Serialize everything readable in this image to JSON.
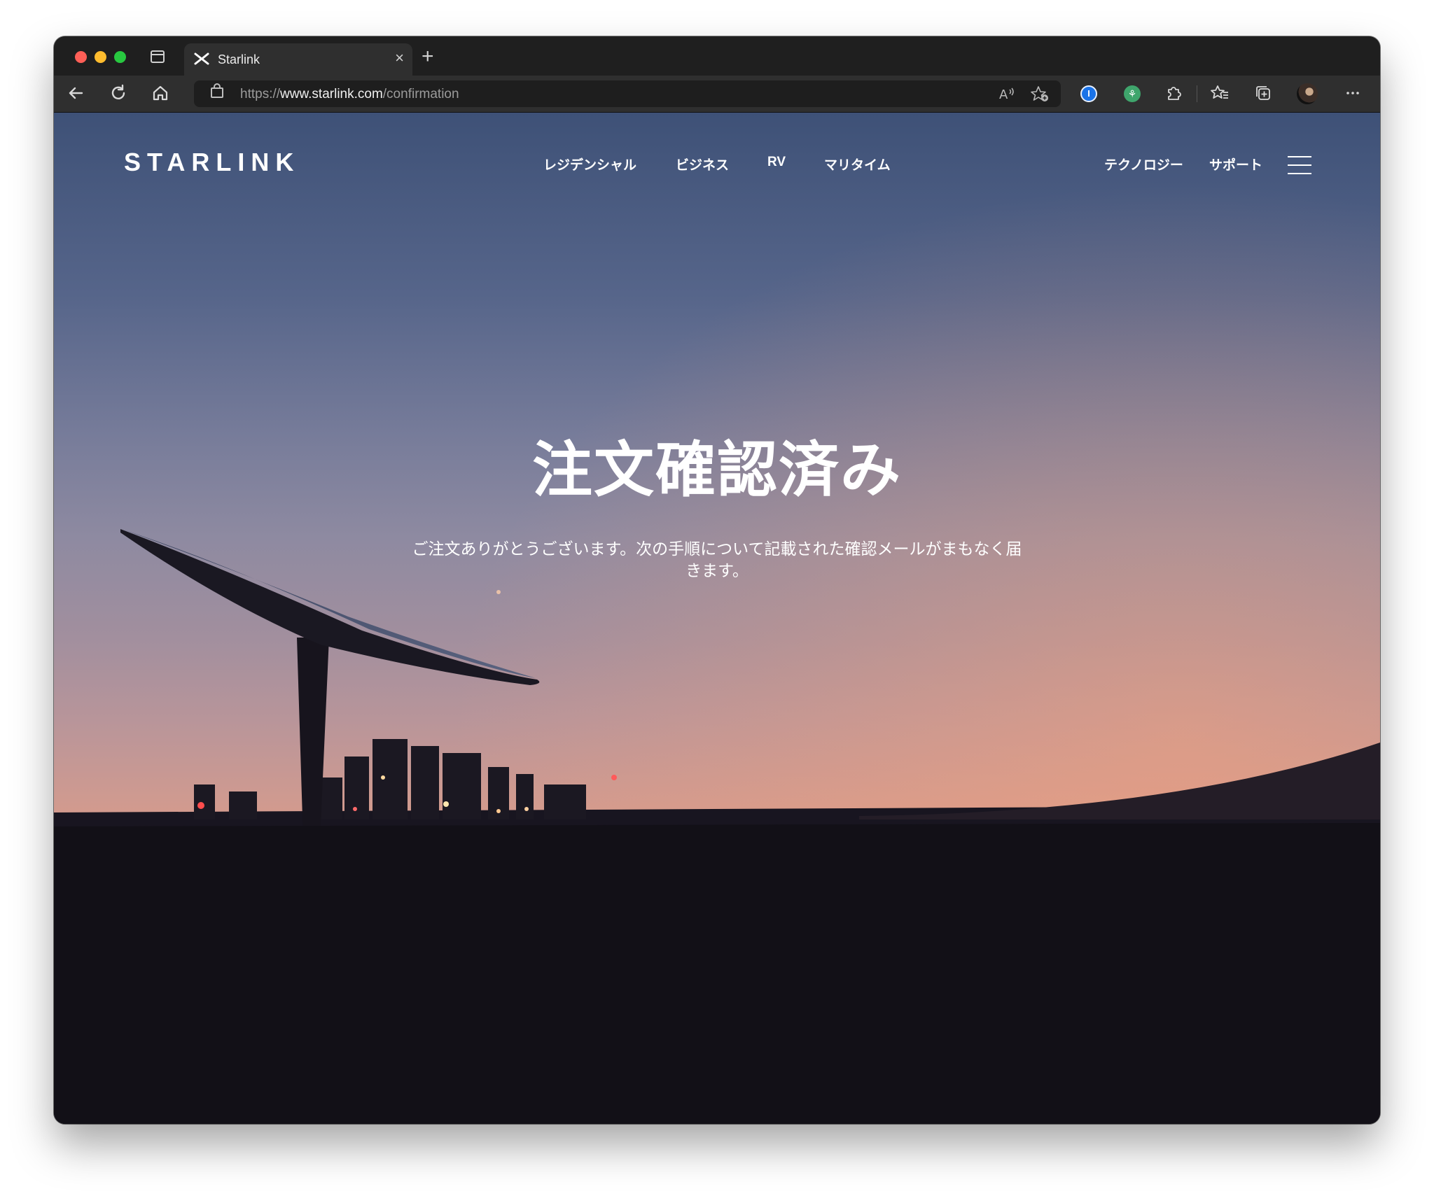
{
  "browser": {
    "tab": {
      "title": "Starlink",
      "close_glyph": "×"
    },
    "new_tab_glyph": "+",
    "url": {
      "scheme": "https://",
      "host": "www.starlink.com",
      "path": "/confirmation"
    }
  },
  "site": {
    "logo": "STARLINK",
    "nav_left": [
      "レジデンシャル",
      "ビジネス",
      "RV",
      "マリタイム"
    ],
    "nav_right": [
      "テクノロジー",
      "サポート"
    ]
  },
  "hero": {
    "title": "注文確認済み",
    "subtitle_line1": "ご注文ありがとうございます。次の手順について記載された確認メールがまもなく届",
    "subtitle_line2": "きます。"
  },
  "icons": [
    "back-icon",
    "reload-icon",
    "home-icon",
    "lock-icon",
    "read-aloud-icon",
    "add-favorite-icon",
    "password-manager-icon",
    "extension-icon",
    "extensions-icon",
    "favorites-icon",
    "collections-icon",
    "profile-avatar",
    "more-icon",
    "menu-icon"
  ]
}
